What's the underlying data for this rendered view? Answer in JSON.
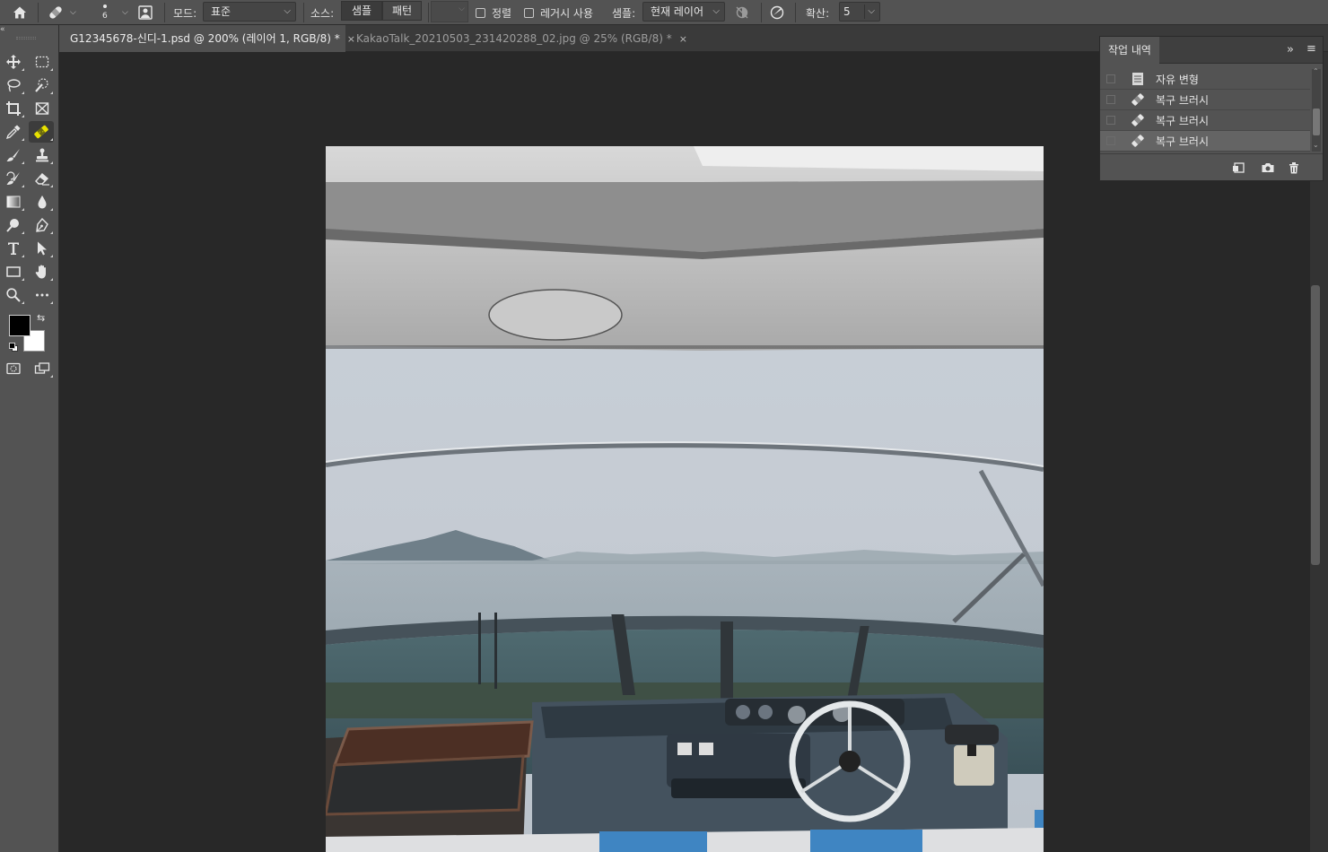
{
  "options_bar": {
    "brush_size": "6",
    "mode_label": "모드:",
    "mode_value": "표준",
    "source_label": "소스:",
    "source_sample": "샘플",
    "source_pattern": "패턴",
    "align_label": "정렬",
    "legacy_label": "레거시 사용",
    "sample_label": "샘플:",
    "sample_value": "현재 레이어",
    "diffusion_label": "확산:",
    "diffusion_value": "5"
  },
  "tabs": [
    {
      "label": "G12345678-신디-1.psd @ 200% (레이어 1, RGB/8) *",
      "close": "×"
    },
    {
      "label": "KakaoTalk_20210503_231420288_02.jpg @ 25% (RGB/8) *",
      "close": "×"
    }
  ],
  "history_panel": {
    "title": "작업 내역",
    "collapse": "»",
    "items": [
      {
        "label": "자유 변형",
        "icon": "document-icon"
      },
      {
        "label": "복구 브러시",
        "icon": "bandage-icon"
      },
      {
        "label": "복구 브러시",
        "icon": "bandage-icon"
      },
      {
        "label": "복구 브러시",
        "icon": "bandage-icon"
      }
    ]
  },
  "colors": {
    "foreground": "#000000",
    "background": "#ffffff",
    "selected_tool_accent": "#e8e100"
  }
}
